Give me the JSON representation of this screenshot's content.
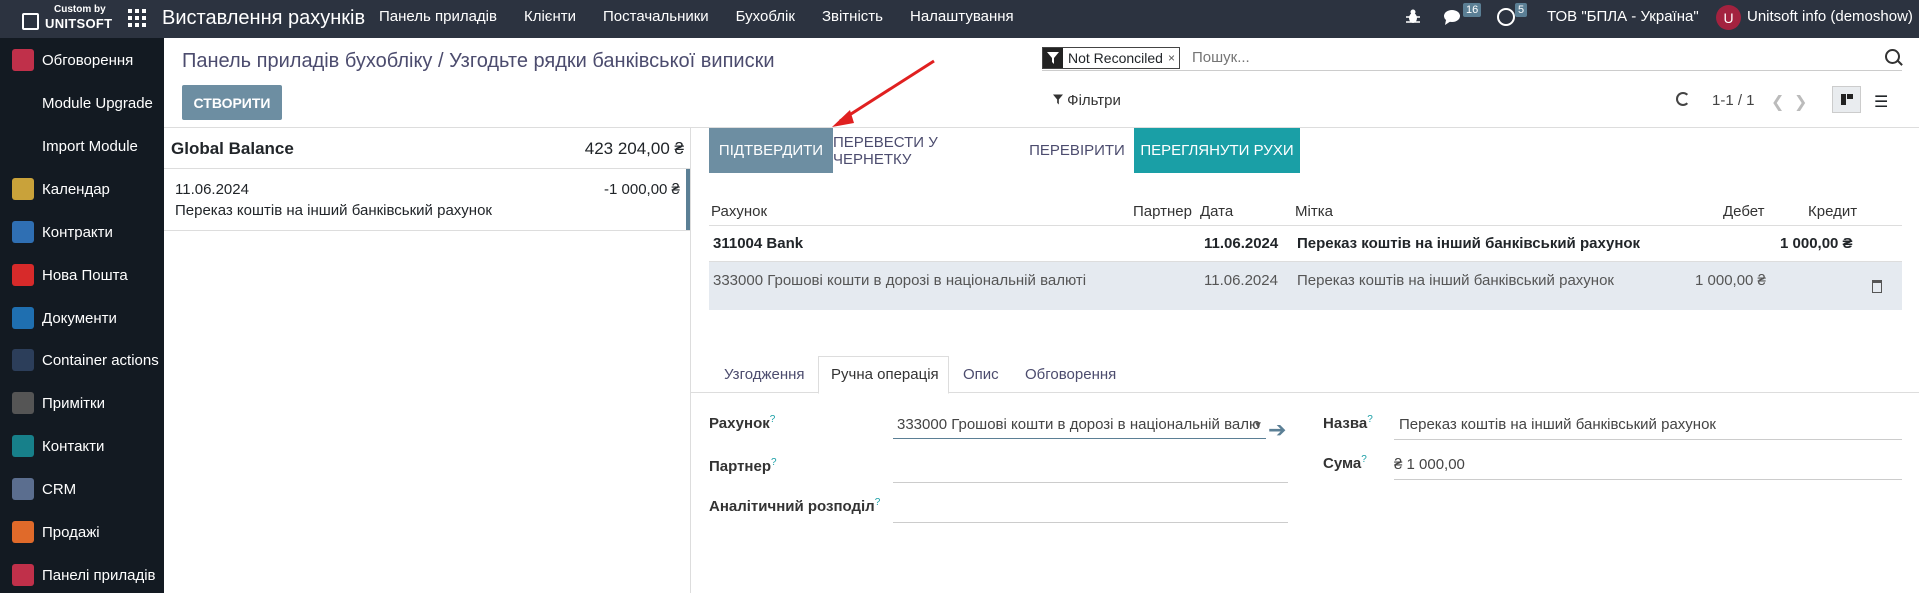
{
  "brand": {
    "line1": "Custom by",
    "line2": "UNITSOFT"
  },
  "app_title": "Виставлення рахунків",
  "menu": [
    "Панель приладів",
    "Клієнти",
    "Постачальники",
    "Бухоблік",
    "Звітність",
    "Налаштування"
  ],
  "system": {
    "messages_count": "16",
    "activities_count": "5",
    "company": "ТОВ \"БПЛА - Україна\"",
    "avatar_letter": "U",
    "user": "Unitsoft info (demoshow)"
  },
  "sidebar": [
    {
      "label": "Обговорення",
      "icon": "chat-icon",
      "color": "#c0304a"
    },
    {
      "label": "Module Upgrade",
      "icon": "",
      "color": ""
    },
    {
      "label": "Import Module",
      "icon": "",
      "color": ""
    },
    {
      "label": "Календар",
      "icon": "calendar-icon",
      "color": "#c9a23a"
    },
    {
      "label": "Контракти",
      "icon": "contract-icon",
      "color": "#2f6fb3"
    },
    {
      "label": "Нова Пошта",
      "icon": "nova-poshta-icon",
      "color": "#d72a2a"
    },
    {
      "label": "Документи",
      "icon": "documents-icon",
      "color": "#1f6fb0"
    },
    {
      "label": "Container actions",
      "icon": "container-icon",
      "color": "#2c3e5a"
    },
    {
      "label": "Примітки",
      "icon": "notes-icon",
      "color": "#555"
    },
    {
      "label": "Контакти",
      "icon": "contacts-icon",
      "color": "#17808a"
    },
    {
      "label": "CRM",
      "icon": "crm-icon",
      "color": "#5b6e8f"
    },
    {
      "label": "Продажі",
      "icon": "sales-icon",
      "color": "#e06a2a"
    },
    {
      "label": "Панелі приладів",
      "icon": "dashboard-icon",
      "color": "#c0304a"
    }
  ],
  "breadcrumb": "Панель приладів бухобліку / Узгодьте рядки банківської виписки",
  "create_label": "СТВОРИТИ",
  "search": {
    "facet": "Not Reconciled",
    "placeholder": "Пошук..."
  },
  "filters_label": "Фільтри",
  "pager": "1-1 / 1",
  "global_balance": {
    "label": "Global Balance",
    "value": "423 204,00 ₴"
  },
  "statement_line": {
    "date": "11.06.2024",
    "amount": "-1 000,00 ₴",
    "description": "Переказ коштів на інший банківський рахунок"
  },
  "actions": {
    "confirm": "ПІДТВЕРДИТИ",
    "to_draft": "ПЕРЕВЕСТИ У ЧЕРНЕТКУ",
    "check": "ПЕРЕВІРИТИ",
    "view_moves": "ПЕРЕГЛЯНУТИ РУХИ"
  },
  "table": {
    "headers": {
      "account": "Рахунок",
      "partner": "Партнер",
      "date": "Дата",
      "label": "Мітка",
      "debit": "Дебет",
      "credit": "Кредит"
    },
    "rows": [
      {
        "account": "311004 Bank",
        "partner": "",
        "date": "11.06.2024",
        "label": "Переказ коштів на інший банківський рахунок",
        "debit": "",
        "credit": "1 000,00 ₴"
      },
      {
        "account": "333000 Грошові кошти в дорозі в національній валюті",
        "partner": "",
        "date": "11.06.2024",
        "label": "Переказ коштів на інший банківський рахунок",
        "debit": "1 000,00 ₴",
        "credit": ""
      }
    ]
  },
  "tabs": [
    "Узгодження",
    "Ручна операція",
    "Опис",
    "Обговорення"
  ],
  "form": {
    "account_label": "Рахунок",
    "account_value": "333000 Грошові кошти в дорозі в національній валю",
    "partner_label": "Партнер",
    "partner_value": "",
    "analytic_label": "Аналітичний розподіл",
    "analytic_value": "",
    "name_label": "Назва",
    "name_value": "Переказ коштів на інший банківський рахунок",
    "amount_label": "Сума",
    "amount_value": "₴ 1 000,00",
    "help_mark": "?"
  }
}
